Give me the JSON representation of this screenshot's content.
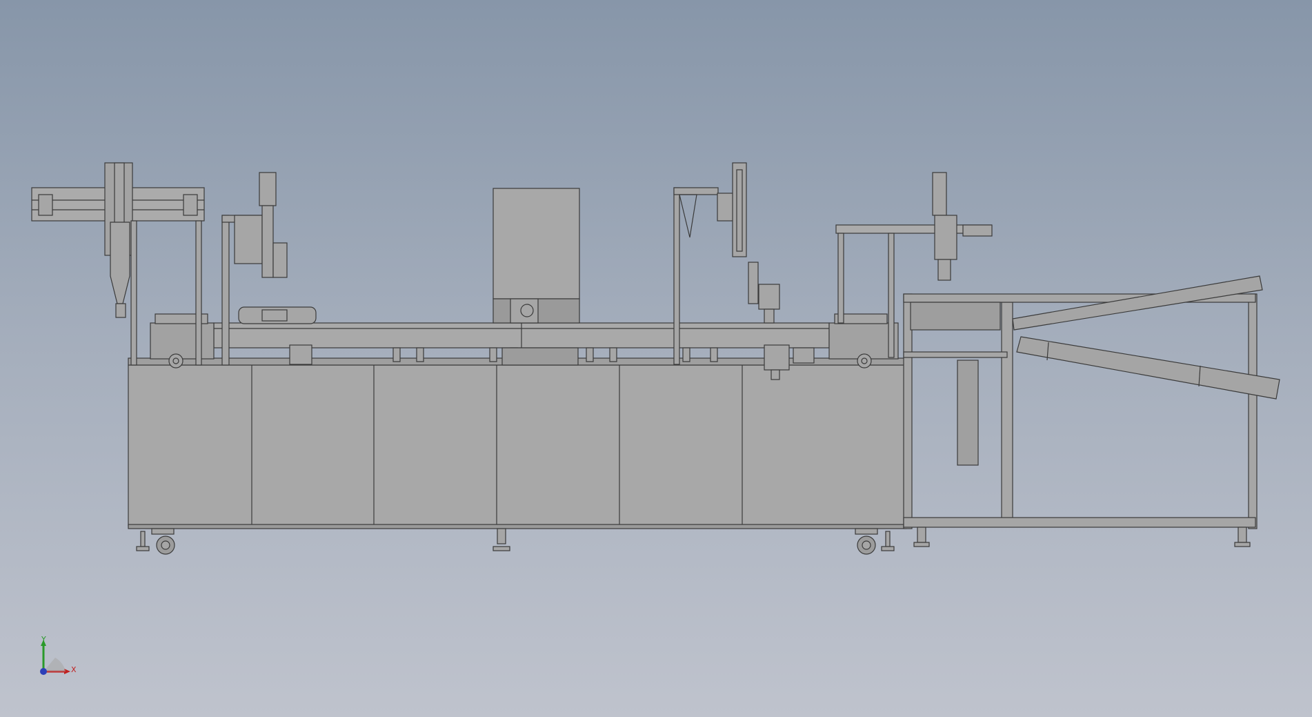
{
  "viewport": {
    "background_top": "#8796a9",
    "background_bottom": "#bfc3cd",
    "model_fill": "#a6a6a6",
    "model_line": "#3a3a3a"
  },
  "triad": {
    "y_label": "Y",
    "x_label": "X",
    "y_color": "#2a9a2a",
    "x_color": "#c02020",
    "z_color": "#2c3fb8"
  }
}
